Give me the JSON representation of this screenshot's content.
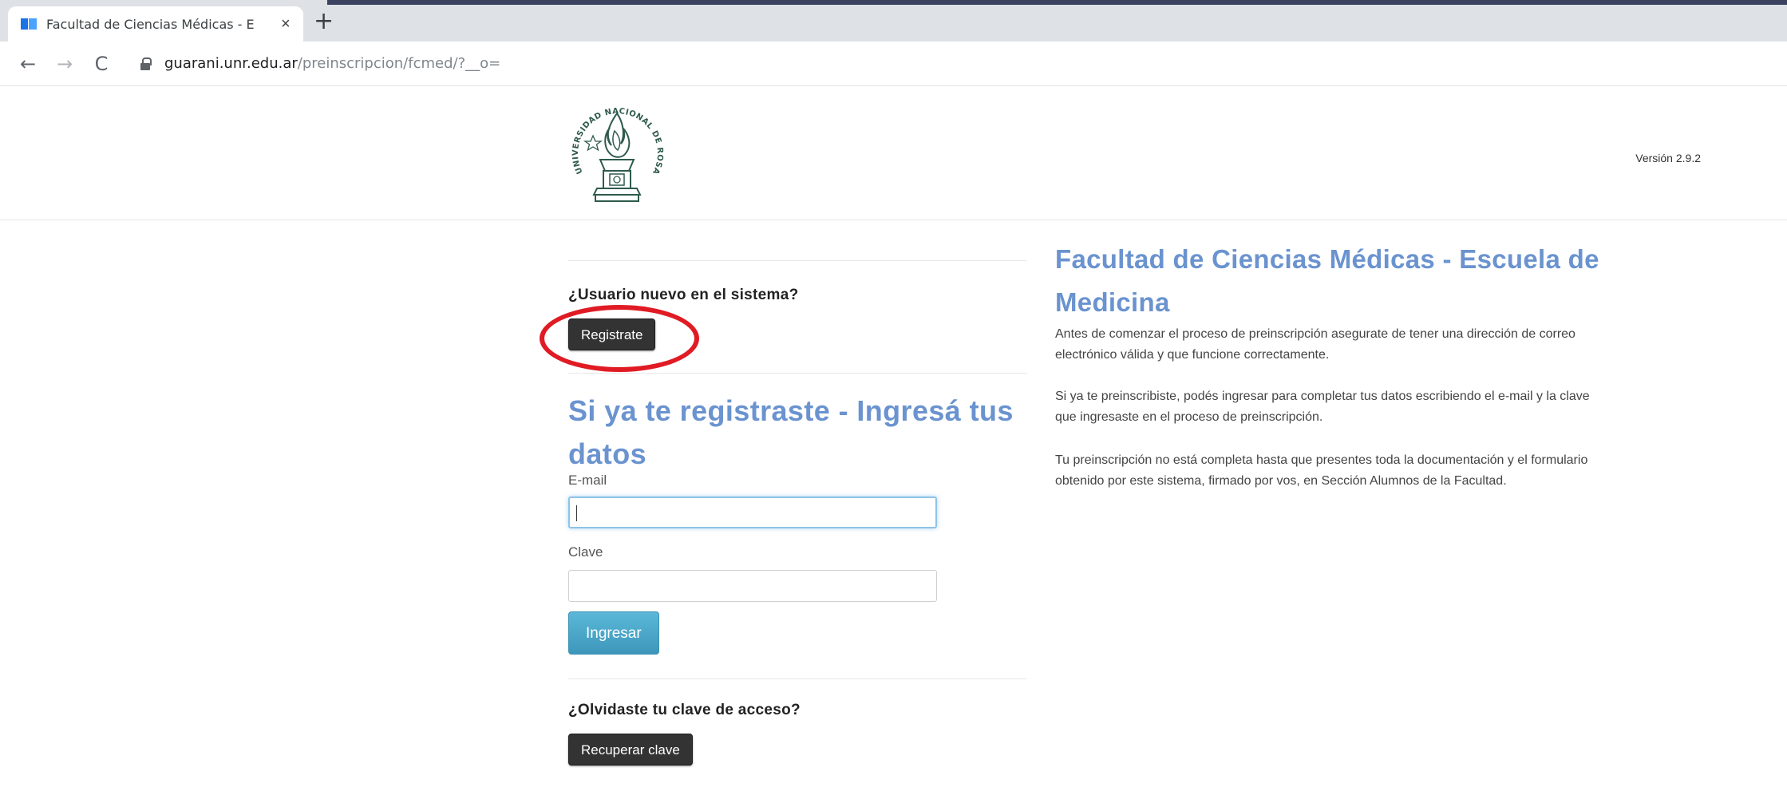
{
  "browser": {
    "tab_title": "Facultad de Ciencias Médicas - E",
    "tab_close": "×",
    "new_tab": "+",
    "url_host": "guarani.unr.edu.ar",
    "url_path": "/preinscripcion/fcmed/?__o=",
    "back": "←",
    "forward": "→",
    "reload": "C"
  },
  "header": {
    "version": "Versión 2.9.2",
    "logo_text": "UNIVERSIDAD NACIONAL DE ROSARIO"
  },
  "left": {
    "new_user_heading": "¿Usuario nuevo en el sistema?",
    "register_button": "Registrate",
    "login_heading_line1": "Si ya te registraste - Ingresá tus",
    "login_heading_line2": "datos",
    "email_label": "E-mail",
    "email_value": "",
    "password_label": "Clave",
    "password_value": "",
    "login_button": "Ingresar",
    "forgot_heading": "¿Olvidaste tu clave de acceso?",
    "recover_button": "Recuperar clave"
  },
  "right": {
    "title_line1": "Facultad de Ciencias Médicas - Escuela de",
    "title_line2": "Medicina",
    "para1_line1": "Antes de comenzar el proceso de preinscripción asegurate de tener una dirección de correo",
    "para1_line2": "electrónico válida y que funcione correctamente.",
    "para2_line1": "Si ya te preinscribiste, podés ingresar para completar tus datos escribiendo el e-mail y la clave",
    "para2_line2": "que ingresaste en el proceso de preinscripción.",
    "para3_line1": "Tu preinscripción no está completa hasta que presentes toda la documentación y el formulario",
    "para3_line2": "obtenido por este sistema, firmado por vos, en Sección Alumnos de la Facultad."
  },
  "colors": {
    "heading_blue": "#6a93cf",
    "primary_button": "#46a4c7",
    "dark_button": "#333333",
    "annotation_red": "#e01b24"
  }
}
